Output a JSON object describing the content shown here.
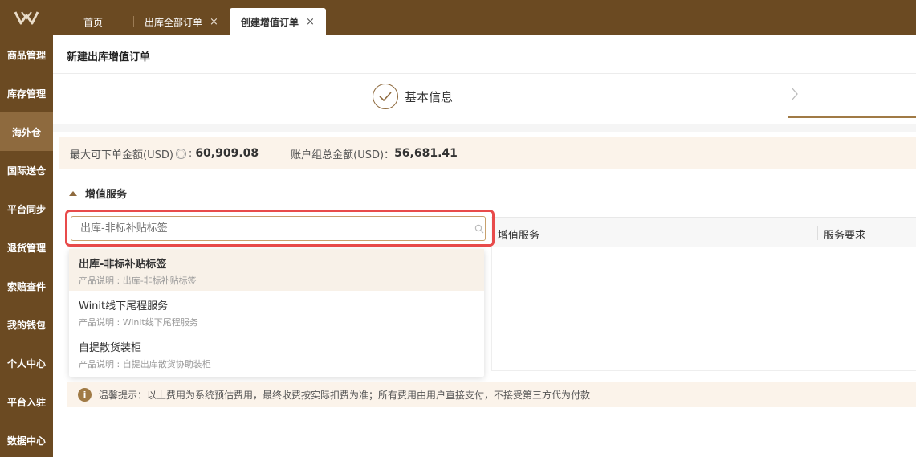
{
  "colors": {
    "sidebar_bg": "#6b4a22",
    "accent": "#a07a45",
    "highlight_border": "#e84b4b"
  },
  "logo": {
    "icon": "winit-logo-icon"
  },
  "nav": {
    "items": [
      {
        "label": "商品管理"
      },
      {
        "label": "库存管理"
      },
      {
        "label": "海外仓"
      },
      {
        "label": "国际送仓"
      },
      {
        "label": "平台同步"
      },
      {
        "label": "退货管理"
      },
      {
        "label": "索赔查件"
      },
      {
        "label": "我的钱包"
      },
      {
        "label": "个人中心"
      },
      {
        "label": "平台入驻"
      },
      {
        "label": "数据中心"
      }
    ],
    "active_label": "海外仓"
  },
  "tabs": [
    {
      "label": "首页",
      "close": ""
    },
    {
      "label": "出库全部订单",
      "close": "×"
    },
    {
      "label": "创建增值订单",
      "close": "×"
    }
  ],
  "page": {
    "title": "新建出库增值订单"
  },
  "steps": {
    "step1_label": "基本信息"
  },
  "amounts": {
    "max_label": "最大可下单金额(USD)",
    "info_icon": "ⓘ",
    "colon": ":",
    "max_value": "60,909.08",
    "group_label": "账户组总金额(USD)：",
    "group_value": "56,681.41"
  },
  "section": {
    "title": "增值服务"
  },
  "table": {
    "col_service": "增值服务",
    "col_requirement": "服务要求"
  },
  "search": {
    "placeholder": "出库-非标补贴标签"
  },
  "dropdown": {
    "options": [
      {
        "title": "出库-非标补贴标签",
        "desc": "产品说明 : 出库-非标补贴标签"
      },
      {
        "title": "Winit线下尾程服务",
        "desc": "产品说明 : Winit线下尾程服务"
      },
      {
        "title": "自提散货装柜",
        "desc": "产品说明 : 自提出库散货协助装柜"
      }
    ]
  },
  "tip": {
    "icon": "i",
    "text": "温馨提示：以上费用为系统预估费用，最终收费按实际扣费为准；所有费用由用户直接支付，不接受第三方代为付款"
  }
}
